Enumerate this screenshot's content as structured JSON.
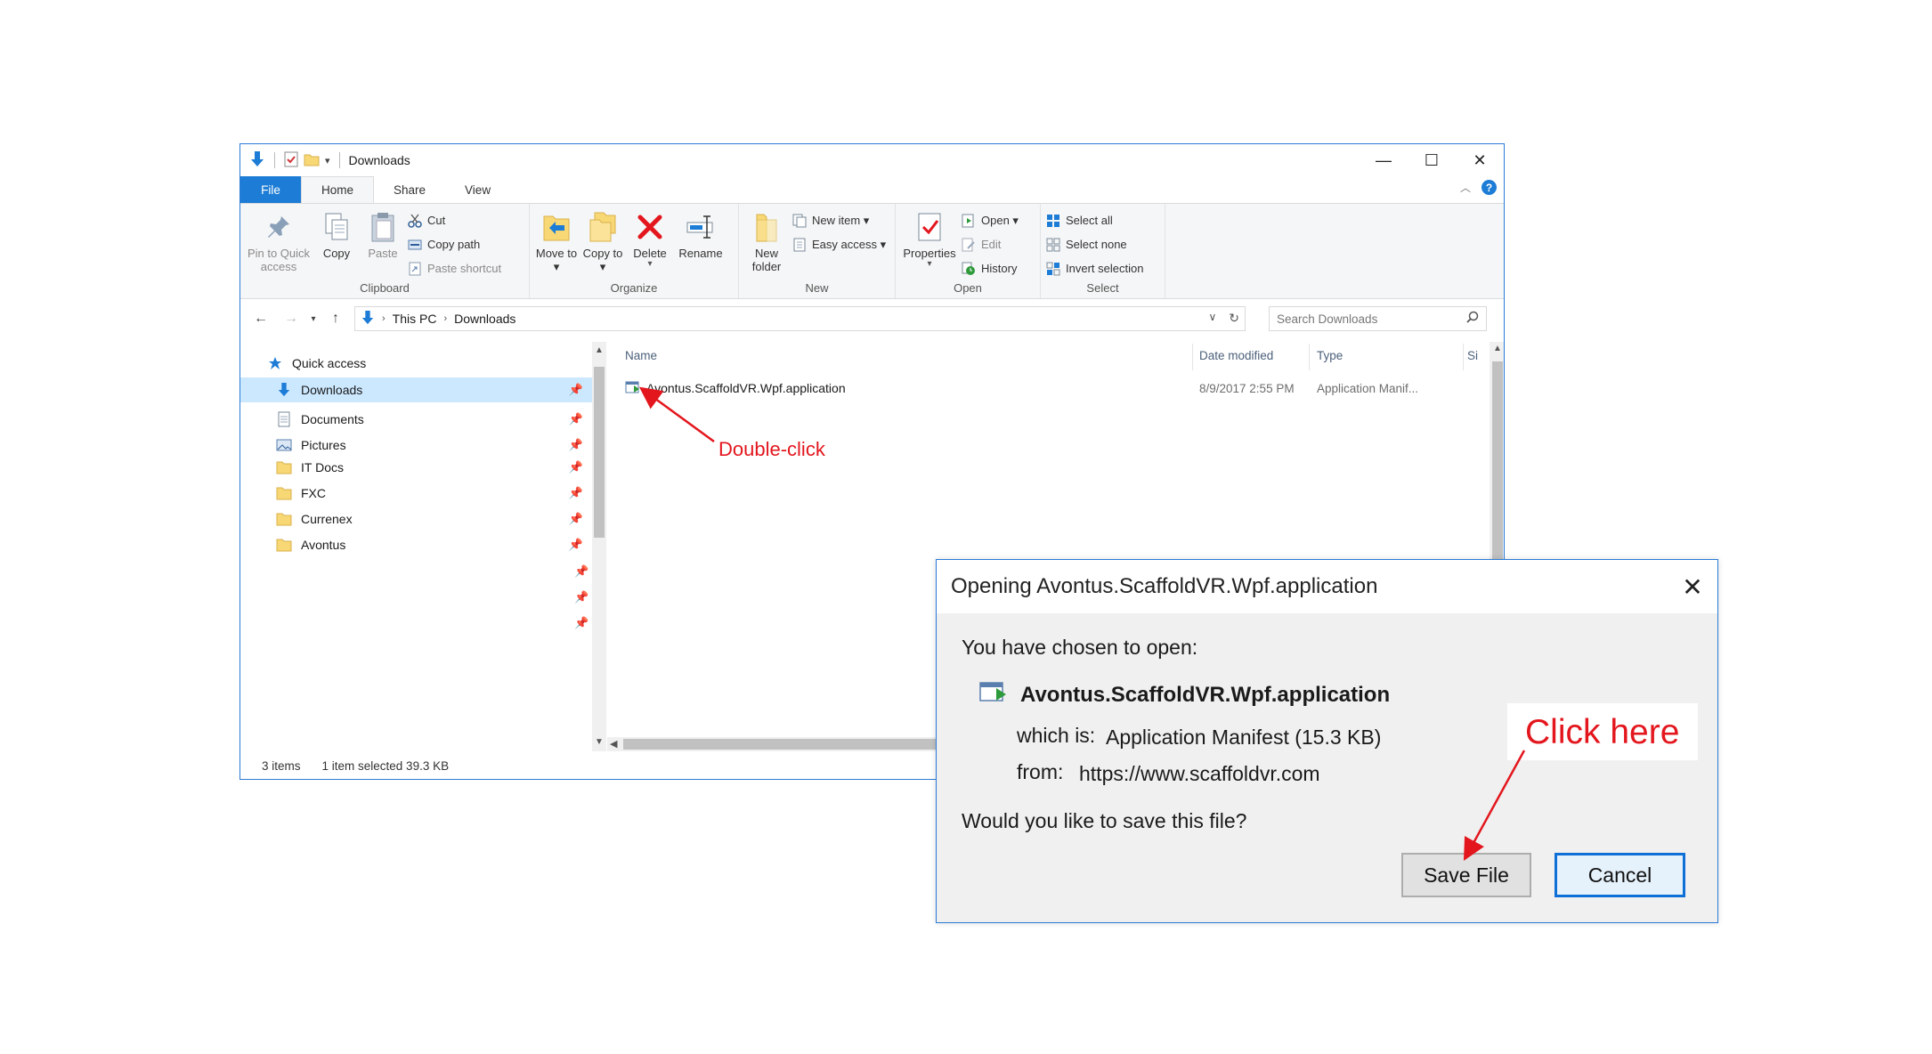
{
  "explorer": {
    "title": "Downloads",
    "window_controls": {
      "minimize": "—",
      "maximize": "☐",
      "close": "✕"
    },
    "tabs": [
      "File",
      "Home",
      "Share",
      "View"
    ],
    "help": "?",
    "ribbon": {
      "clipboard": {
        "label": "Clipboard",
        "pin_to_quick_access": "Pin to Quick access",
        "copy": "Copy",
        "paste": "Paste",
        "cut": "Cut",
        "copy_path": "Copy path",
        "paste_shortcut": "Paste shortcut"
      },
      "organize": {
        "label": "Organize",
        "move_to": "Move to ▾",
        "copy_to": "Copy to ▾",
        "delete": "Delete",
        "rename": "Rename"
      },
      "new": {
        "label": "New",
        "new_folder": "New folder",
        "new_item": "New item ▾",
        "easy_access": "Easy access ▾"
      },
      "open": {
        "label": "Open",
        "properties": "Properties",
        "open": "Open ▾",
        "edit": "Edit",
        "history": "History"
      },
      "select": {
        "label": "Select",
        "select_all": "Select all",
        "select_none": "Select none",
        "invert_selection": "Invert selection"
      }
    },
    "address": {
      "segments": [
        "This PC",
        "Downloads"
      ],
      "search_placeholder": "Search Downloads"
    },
    "nav": {
      "quick_access": "Quick access",
      "items": [
        "Downloads",
        "Documents",
        "Pictures",
        "IT Docs",
        "FXC",
        "Currenex",
        "Avontus"
      ]
    },
    "columns": {
      "name": "Name",
      "date_modified": "Date modified",
      "type": "Type",
      "size": "Si"
    },
    "files": [
      {
        "name": "Avontus.ScaffoldVR.Wpf.application",
        "date": "8/9/2017 2:55 PM",
        "type": "Application Manif..."
      }
    ],
    "status": {
      "items": "3 items",
      "selected": "1 item selected  39.3 KB"
    }
  },
  "annotations": {
    "double_click": "Double-click",
    "click_here": "Click here"
  },
  "dialog": {
    "title": "Opening Avontus.ScaffoldVR.Wpf.application",
    "close": "✕",
    "intro": "You have chosen to open:",
    "file_name": "Avontus.ScaffoldVR.Wpf.application",
    "which_is_label": "which is:",
    "which_is_value": "Application Manifest (15.3 KB)",
    "from_label": "from:",
    "from_value": "https://www.scaffoldvr.com",
    "question": "Would you like to save this file?",
    "save_button": "Save File",
    "cancel_button": "Cancel"
  },
  "colors": {
    "accent": "#1c7cd6",
    "annotation": "#e3161d",
    "folder": "#f8d775"
  }
}
